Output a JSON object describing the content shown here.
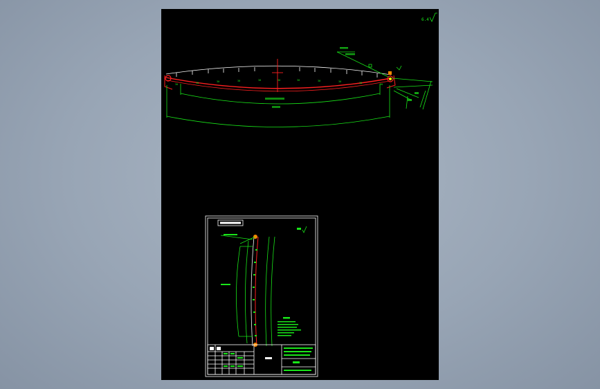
{
  "viewport": {
    "background": "#98a5b5",
    "sheet_background": "#000000"
  },
  "colors": {
    "green": "#19e619",
    "white": "#ffffff",
    "red": "#ff2020",
    "yellow": "#ffff00"
  },
  "main_drawing": {
    "roughness_value": "6.4",
    "dim_segments": [
      "30",
      "30",
      "30",
      "30",
      "30",
      "30",
      "30",
      "30",
      "30",
      "30",
      "30"
    ],
    "overall_dim": "",
    "callout": ""
  },
  "title_block": {}
}
